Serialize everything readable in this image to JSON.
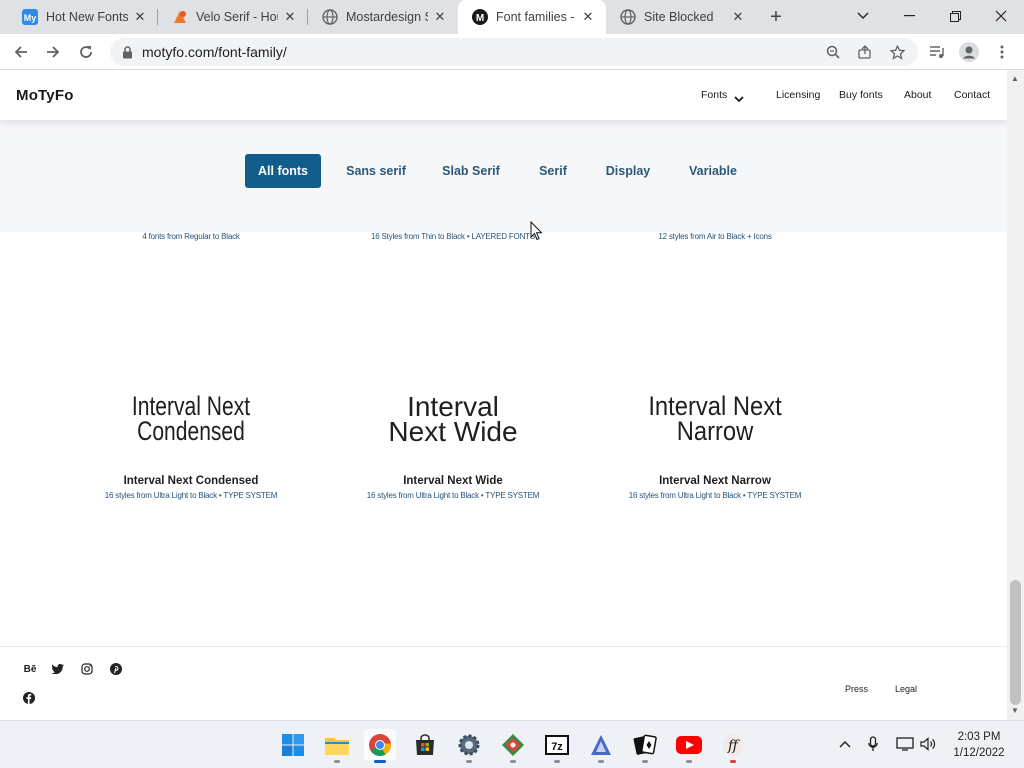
{
  "browser": {
    "tabs": [
      {
        "title": "Hot New Fonts | ",
        "favicon": "myfonts-icon",
        "active": false
      },
      {
        "title": "Velo Serif - Hou",
        "favicon": "velo-icon",
        "active": false
      },
      {
        "title": "Mostardesign St",
        "favicon": "globe-icon",
        "active": false
      },
      {
        "title": "Font families - M",
        "favicon": "motyfo-icon",
        "favicon_text": "M",
        "active": true
      },
      {
        "title": "Site Blocked",
        "favicon": "globe-icon",
        "active": false
      }
    ],
    "url": "motyfo.com/font-family/"
  },
  "site": {
    "logo": "MoTyFo",
    "nav": [
      {
        "label": "Fonts"
      },
      {
        "label": "Licensing"
      },
      {
        "label": "Buy fonts"
      },
      {
        "label": "About"
      },
      {
        "label": "Contact"
      }
    ],
    "filters": [
      {
        "label": "All fonts",
        "active": true
      },
      {
        "label": "Sans serif",
        "active": false
      },
      {
        "label": "Slab Serif",
        "active": false
      },
      {
        "label": "Serif",
        "active": false
      },
      {
        "label": "Display",
        "active": false
      },
      {
        "label": "Variable",
        "active": false
      }
    ],
    "top_row_descriptions": [
      "4 fonts from Regular to Black",
      "16 Styles from Thin to Black • LAYERED FONTS",
      "12 styles from Air to Black + Icons"
    ],
    "fonts": [
      {
        "specimen_line1": "Interval Next",
        "specimen_line2": "Condensed",
        "name": "Interval Next Condensed",
        "description": "16 styles from Ultra Light to Black  • TYPE SYSTEM"
      },
      {
        "specimen_line1": "Interval",
        "specimen_line2": "Next Wide",
        "name": "Interval Next Wide",
        "description": "16 styles from Ultra Light to Black  • TYPE SYSTEM"
      },
      {
        "specimen_line1": "Interval Next",
        "specimen_line2": "Narrow",
        "name": "Interval Next Narrow",
        "description": "16 styles from Ultra Light to Black  • TYPE SYSTEM"
      }
    ],
    "footer": {
      "social": [
        {
          "label": "Bē",
          "icon": "behance-icon"
        },
        {
          "label": "",
          "icon": "twitter-icon"
        },
        {
          "label": "",
          "icon": "instagram-icon"
        },
        {
          "label": "",
          "icon": "pinterest-icon"
        },
        {
          "label": "",
          "icon": "facebook-icon"
        }
      ],
      "links": [
        {
          "label": "Press"
        },
        {
          "label": "Legal"
        }
      ]
    }
  },
  "taskbar": {
    "time": "2:03 PM",
    "date": "1/12/2022"
  },
  "colors": {
    "accent": "#115d8c",
    "filter_text": "#2c5877",
    "description_text": "#27527a"
  }
}
